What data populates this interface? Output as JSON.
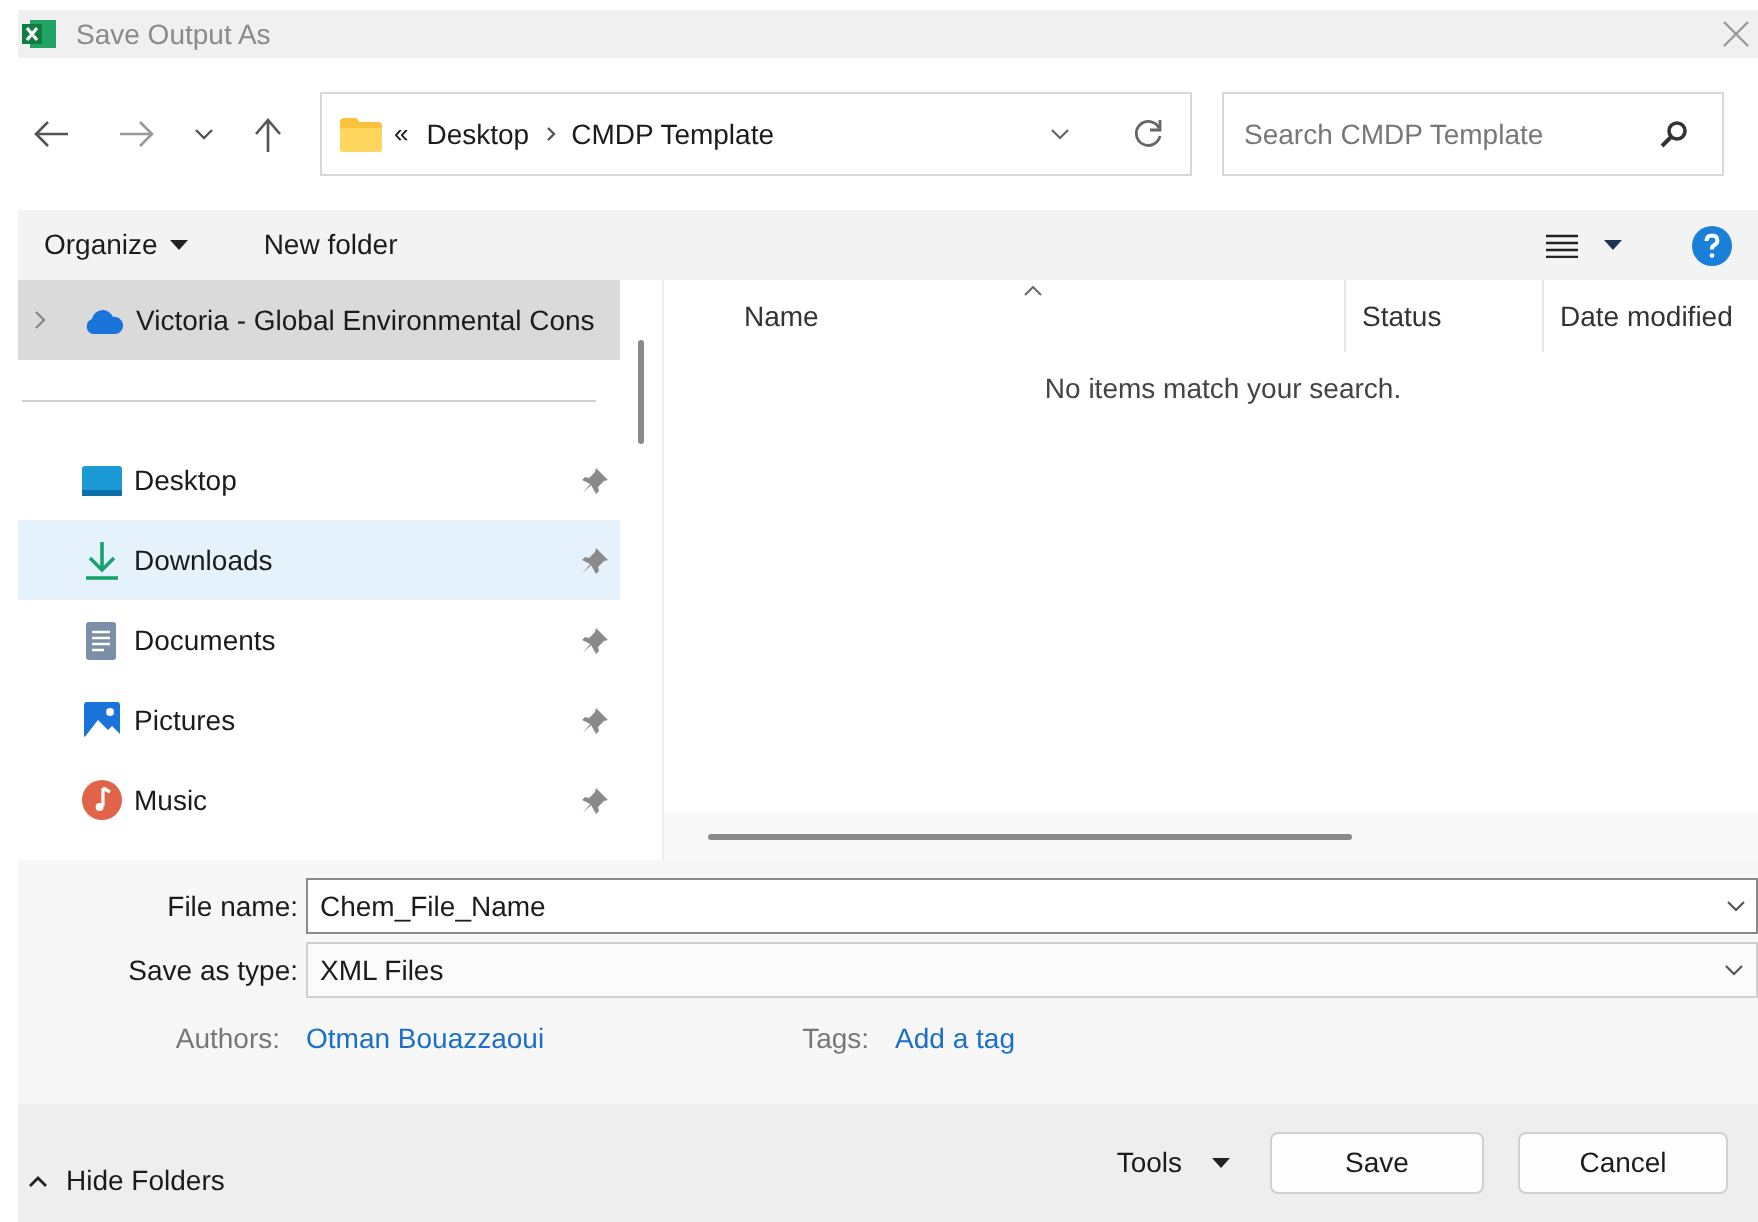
{
  "window": {
    "title": "Save Output As"
  },
  "address": {
    "parts": [
      "Desktop",
      "CMDP Template"
    ],
    "overflow": "«"
  },
  "search": {
    "placeholder": "Search CMDP Template"
  },
  "commands": {
    "organize": "Organize",
    "new_folder": "New folder"
  },
  "tree": [
    {
      "label": "Victoria - Global Environmental Cons",
      "expanded": false,
      "selected": true,
      "kind": "cloud"
    }
  ],
  "quick_access": [
    {
      "label": "Desktop",
      "kind": "desktop",
      "pinned": true,
      "hovered": false
    },
    {
      "label": "Downloads",
      "kind": "download",
      "pinned": true,
      "hovered": true
    },
    {
      "label": "Documents",
      "kind": "document",
      "pinned": true,
      "hovered": false
    },
    {
      "label": "Pictures",
      "kind": "pictures",
      "pinned": true,
      "hovered": false
    },
    {
      "label": "Music",
      "kind": "music",
      "pinned": true,
      "hovered": false
    }
  ],
  "columns": [
    {
      "label": "Name",
      "sorted": true
    },
    {
      "label": "Status",
      "sorted": false
    },
    {
      "label": "Date modified",
      "sorted": false
    }
  ],
  "empty_message": "No items match your search.",
  "file_name": {
    "label": "File name:",
    "value": "Chem_File_Name"
  },
  "save_as_type": {
    "label": "Save as type:",
    "value": "XML Files"
  },
  "authors": {
    "label": "Authors:",
    "value": "Otman Bouazzaoui"
  },
  "tags": {
    "label": "Tags:",
    "value": "Add a tag"
  },
  "footer": {
    "hide_folders": "Hide Folders",
    "tools": "Tools",
    "save": "Save",
    "cancel": "Cancel"
  }
}
